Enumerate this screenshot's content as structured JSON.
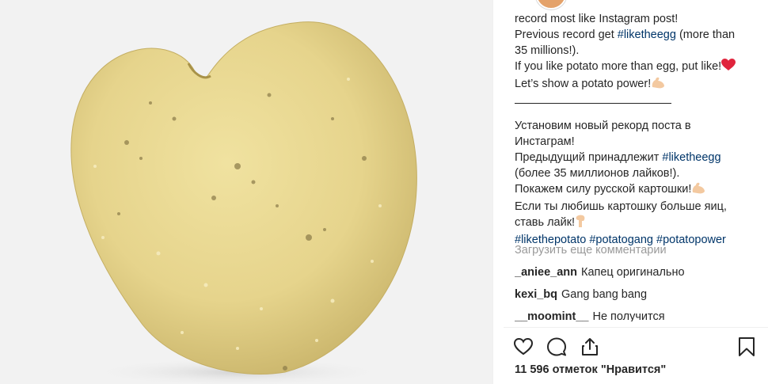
{
  "post": {
    "image": {
      "subject": "heart-shaped potato",
      "colors": {
        "background": "#f2f2f2",
        "potato": "#e6d48c",
        "shadow": "#b9a45a"
      }
    },
    "caption_en": [
      "record most like Instagram post!",
      {
        "before": "Previous record get ",
        "tag": "#liketheegg",
        "after": " (more than"
      },
      "35 millions!).",
      {
        "text": "If you like potato more than egg, put like!",
        "emoji": "heart"
      },
      {
        "text": "Let’s show a potato power!",
        "emoji": "flexed-biceps"
      }
    ],
    "caption_ru": [
      "Установим новый рекорд поста в",
      "Инстаграм!",
      {
        "before": "Предыдущий принадлежит ",
        "tag": "#liketheegg"
      },
      "(более 35 миллионов лайков!).",
      {
        "text": "Покажем силу русской картошки!",
        "emoji": "flexed-biceps"
      },
      "Если ты любишь картошку больше яиц,",
      {
        "text": "ставь лайк!",
        "emoji": "pointing-down"
      }
    ],
    "hashtags": [
      "#likethepotato",
      "#potatogang",
      "#potatopower"
    ],
    "load_more": "Загрузить еще комментарии",
    "comments": [
      {
        "user": "_aniee_ann",
        "text": "Капец оригинально"
      },
      {
        "user": "kexi_bq",
        "text": "Gang bang bang"
      },
      {
        "user": "__moomint__",
        "text": "Не получится"
      }
    ],
    "actions": {
      "like": "heart-icon",
      "comment": "comment-icon",
      "share": "share-icon",
      "save": "bookmark-icon"
    },
    "likes": "11 596 отметок \"Нравится\"",
    "accent": "#003569"
  }
}
